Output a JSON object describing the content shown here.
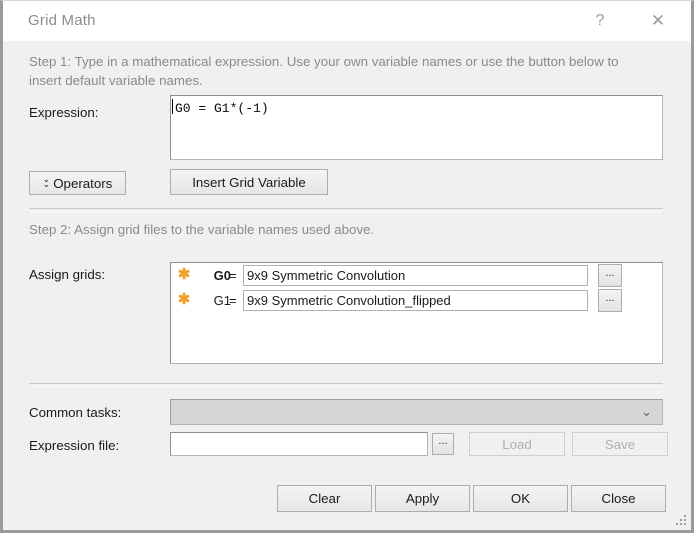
{
  "window": {
    "title": "Grid Math",
    "help_icon": "question-mark-icon",
    "close_icon": "close-x-icon",
    "help_label": "?",
    "close_label": "✕"
  },
  "step1": {
    "text": "Step 1: Type in a mathematical expression. Use your own variable names or use the button below to insert default variable names."
  },
  "expression": {
    "label": "Expression:",
    "value": "G0 = G1*(-1)",
    "placeholder": ""
  },
  "toolbar": {
    "operators_label": "Operators",
    "operators_icon": "double-chevron-down-icon",
    "insert_grid_variable_label": "Insert Grid Variable"
  },
  "step2": {
    "text": "Step 2: Assign grid files to the variable names used above."
  },
  "assign_grids": {
    "label": "Assign grids:",
    "rows": [
      {
        "marker_icon": "asterisk-icon",
        "variable": "G0",
        "equals": "=",
        "value": "9x9 Symmetric Convolution",
        "browse_label": "...",
        "bold": true
      },
      {
        "marker_icon": "asterisk-icon",
        "variable": "G1",
        "equals": "=",
        "value": "9x9 Symmetric Convolution_flipped",
        "browse_label": "...",
        "bold": false
      }
    ]
  },
  "common_tasks": {
    "label": "Common tasks:",
    "selected": "",
    "chevron_icon": "chevron-down-icon",
    "chevron_label": "⌄",
    "enabled": false
  },
  "expression_file": {
    "label": "Expression file:",
    "value": "",
    "placeholder": "",
    "browse_label": "...",
    "load_label": "Load",
    "save_label": "Save",
    "load_enabled": false,
    "save_enabled": false
  },
  "footer": {
    "clear_label": "Clear",
    "apply_label": "Apply",
    "ok_label": "OK",
    "close_label": "Close"
  },
  "colors": {
    "accent_orange": "#f0a229",
    "dialog_bg": "#f0f0f0",
    "titlebar_bg": "#ffffff",
    "title_text": "#8d8d8d",
    "step_text": "#8a8a8a",
    "field_bg": "#ffffff",
    "disabled_bg": "#d6d6d6"
  }
}
